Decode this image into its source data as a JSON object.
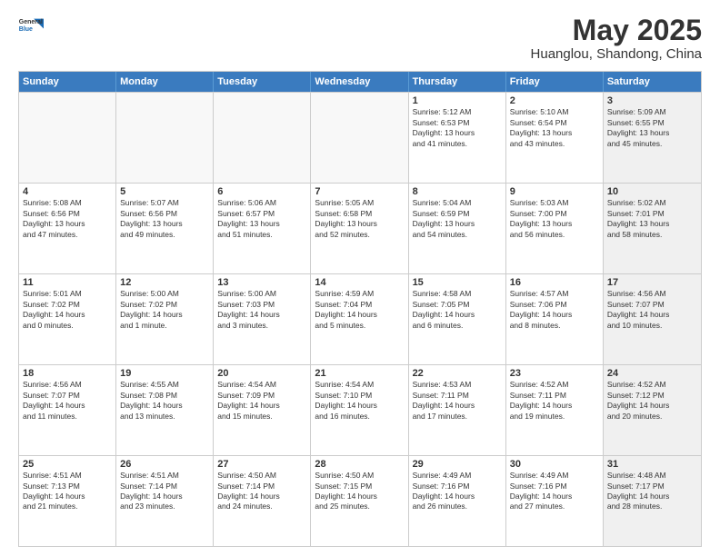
{
  "header": {
    "logo_general": "General",
    "logo_blue": "Blue",
    "month": "May 2025",
    "location": "Huanglou, Shandong, China"
  },
  "days": [
    "Sunday",
    "Monday",
    "Tuesday",
    "Wednesday",
    "Thursday",
    "Friday",
    "Saturday"
  ],
  "rows": [
    [
      {
        "day": "",
        "content": "",
        "empty": true
      },
      {
        "day": "",
        "content": "",
        "empty": true
      },
      {
        "day": "",
        "content": "",
        "empty": true
      },
      {
        "day": "",
        "content": "",
        "empty": true
      },
      {
        "day": "1",
        "content": "Sunrise: 5:12 AM\nSunset: 6:53 PM\nDaylight: 13 hours\nand 41 minutes.",
        "empty": false
      },
      {
        "day": "2",
        "content": "Sunrise: 5:10 AM\nSunset: 6:54 PM\nDaylight: 13 hours\nand 43 minutes.",
        "empty": false
      },
      {
        "day": "3",
        "content": "Sunrise: 5:09 AM\nSunset: 6:55 PM\nDaylight: 13 hours\nand 45 minutes.",
        "empty": false,
        "shaded": true
      }
    ],
    [
      {
        "day": "4",
        "content": "Sunrise: 5:08 AM\nSunset: 6:56 PM\nDaylight: 13 hours\nand 47 minutes.",
        "empty": false
      },
      {
        "day": "5",
        "content": "Sunrise: 5:07 AM\nSunset: 6:56 PM\nDaylight: 13 hours\nand 49 minutes.",
        "empty": false
      },
      {
        "day": "6",
        "content": "Sunrise: 5:06 AM\nSunset: 6:57 PM\nDaylight: 13 hours\nand 51 minutes.",
        "empty": false
      },
      {
        "day": "7",
        "content": "Sunrise: 5:05 AM\nSunset: 6:58 PM\nDaylight: 13 hours\nand 52 minutes.",
        "empty": false
      },
      {
        "day": "8",
        "content": "Sunrise: 5:04 AM\nSunset: 6:59 PM\nDaylight: 13 hours\nand 54 minutes.",
        "empty": false
      },
      {
        "day": "9",
        "content": "Sunrise: 5:03 AM\nSunset: 7:00 PM\nDaylight: 13 hours\nand 56 minutes.",
        "empty": false
      },
      {
        "day": "10",
        "content": "Sunrise: 5:02 AM\nSunset: 7:01 PM\nDaylight: 13 hours\nand 58 minutes.",
        "empty": false,
        "shaded": true
      }
    ],
    [
      {
        "day": "11",
        "content": "Sunrise: 5:01 AM\nSunset: 7:02 PM\nDaylight: 14 hours\nand 0 minutes.",
        "empty": false
      },
      {
        "day": "12",
        "content": "Sunrise: 5:00 AM\nSunset: 7:02 PM\nDaylight: 14 hours\nand 1 minute.",
        "empty": false
      },
      {
        "day": "13",
        "content": "Sunrise: 5:00 AM\nSunset: 7:03 PM\nDaylight: 14 hours\nand 3 minutes.",
        "empty": false
      },
      {
        "day": "14",
        "content": "Sunrise: 4:59 AM\nSunset: 7:04 PM\nDaylight: 14 hours\nand 5 minutes.",
        "empty": false
      },
      {
        "day": "15",
        "content": "Sunrise: 4:58 AM\nSunset: 7:05 PM\nDaylight: 14 hours\nand 6 minutes.",
        "empty": false
      },
      {
        "day": "16",
        "content": "Sunrise: 4:57 AM\nSunset: 7:06 PM\nDaylight: 14 hours\nand 8 minutes.",
        "empty": false
      },
      {
        "day": "17",
        "content": "Sunrise: 4:56 AM\nSunset: 7:07 PM\nDaylight: 14 hours\nand 10 minutes.",
        "empty": false,
        "shaded": true
      }
    ],
    [
      {
        "day": "18",
        "content": "Sunrise: 4:56 AM\nSunset: 7:07 PM\nDaylight: 14 hours\nand 11 minutes.",
        "empty": false
      },
      {
        "day": "19",
        "content": "Sunrise: 4:55 AM\nSunset: 7:08 PM\nDaylight: 14 hours\nand 13 minutes.",
        "empty": false
      },
      {
        "day": "20",
        "content": "Sunrise: 4:54 AM\nSunset: 7:09 PM\nDaylight: 14 hours\nand 15 minutes.",
        "empty": false
      },
      {
        "day": "21",
        "content": "Sunrise: 4:54 AM\nSunset: 7:10 PM\nDaylight: 14 hours\nand 16 minutes.",
        "empty": false
      },
      {
        "day": "22",
        "content": "Sunrise: 4:53 AM\nSunset: 7:11 PM\nDaylight: 14 hours\nand 17 minutes.",
        "empty": false
      },
      {
        "day": "23",
        "content": "Sunrise: 4:52 AM\nSunset: 7:11 PM\nDaylight: 14 hours\nand 19 minutes.",
        "empty": false
      },
      {
        "day": "24",
        "content": "Sunrise: 4:52 AM\nSunset: 7:12 PM\nDaylight: 14 hours\nand 20 minutes.",
        "empty": false,
        "shaded": true
      }
    ],
    [
      {
        "day": "25",
        "content": "Sunrise: 4:51 AM\nSunset: 7:13 PM\nDaylight: 14 hours\nand 21 minutes.",
        "empty": false
      },
      {
        "day": "26",
        "content": "Sunrise: 4:51 AM\nSunset: 7:14 PM\nDaylight: 14 hours\nand 23 minutes.",
        "empty": false
      },
      {
        "day": "27",
        "content": "Sunrise: 4:50 AM\nSunset: 7:14 PM\nDaylight: 14 hours\nand 24 minutes.",
        "empty": false
      },
      {
        "day": "28",
        "content": "Sunrise: 4:50 AM\nSunset: 7:15 PM\nDaylight: 14 hours\nand 25 minutes.",
        "empty": false
      },
      {
        "day": "29",
        "content": "Sunrise: 4:49 AM\nSunset: 7:16 PM\nDaylight: 14 hours\nand 26 minutes.",
        "empty": false
      },
      {
        "day": "30",
        "content": "Sunrise: 4:49 AM\nSunset: 7:16 PM\nDaylight: 14 hours\nand 27 minutes.",
        "empty": false
      },
      {
        "day": "31",
        "content": "Sunrise: 4:48 AM\nSunset: 7:17 PM\nDaylight: 14 hours\nand 28 minutes.",
        "empty": false,
        "shaded": true
      }
    ]
  ]
}
